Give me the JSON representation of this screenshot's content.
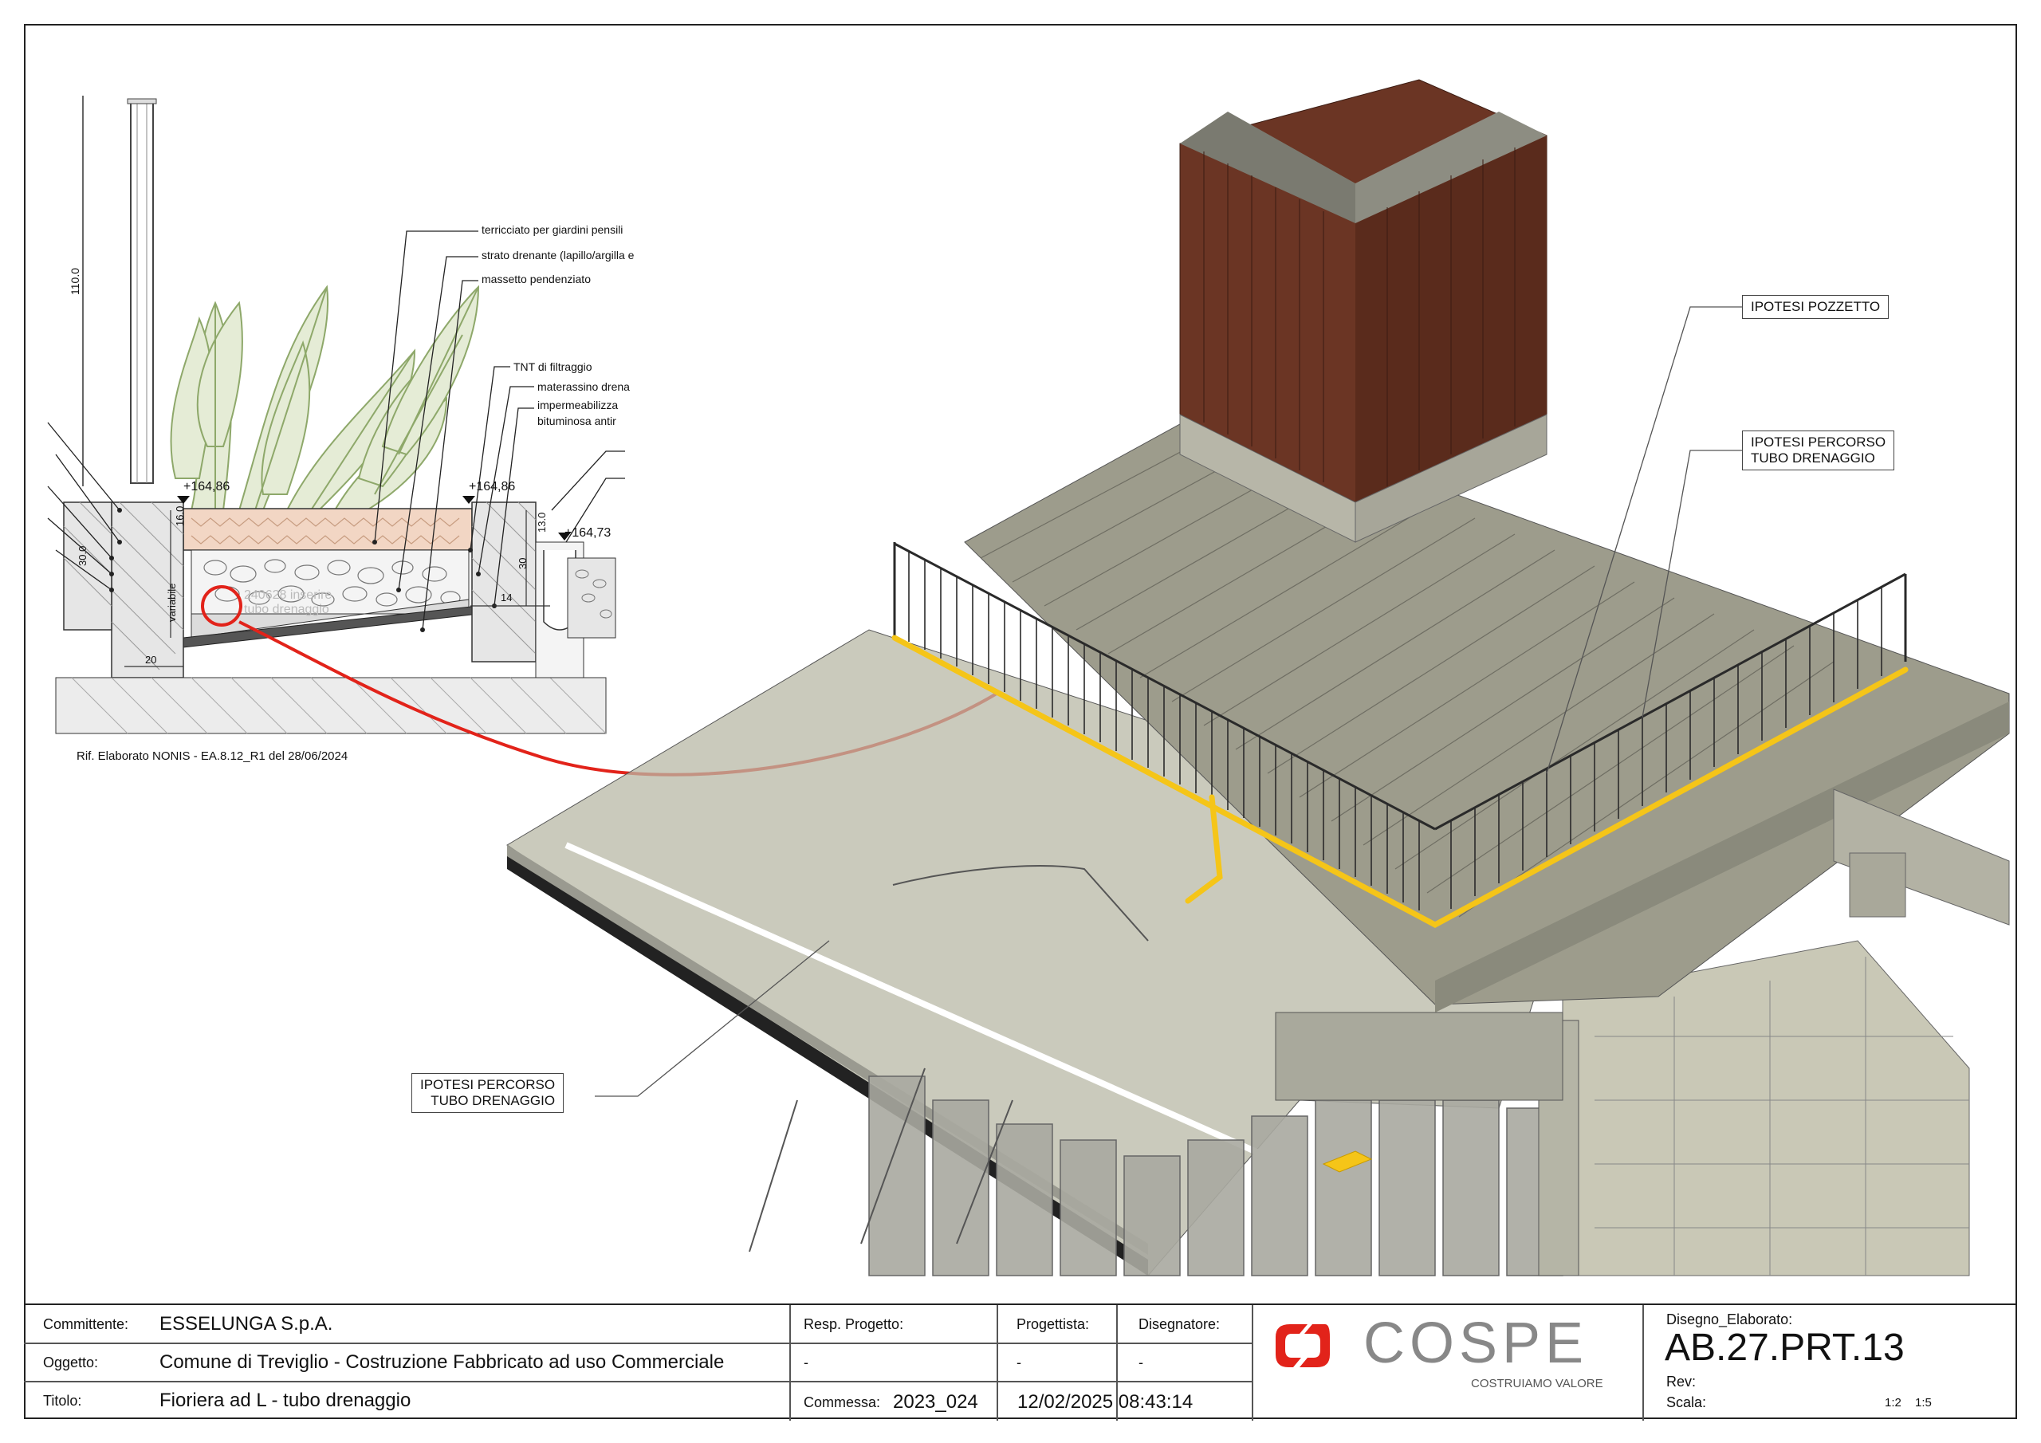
{
  "detail": {
    "labels": {
      "l1": "terricciato per giardini pensili",
      "l2": "strato drenante (lapillo/argilla e",
      "l3": "massetto pendenziato",
      "l4": "TNT di filtraggio",
      "l5": "materassino drena",
      "l6": "impermeabilizza",
      "l7": "bituminosa antir"
    },
    "dims": {
      "h110": "110.0",
      "h30a": "30.0",
      "varia": "variabile",
      "h16": "16.0",
      "w20": "20",
      "h13": "13.0",
      "h30b": "30",
      "w14": "14"
    },
    "levels": {
      "lv1": "+164,86",
      "lv2": "+164,86",
      "lv3": "+164,73"
    },
    "note": "240628 inserire tubo drenaggio",
    "reference": "Rif. Elaborato NONIS - EA.8.12_R1 del 28/06/2024"
  },
  "callouts": {
    "pozzetto": "IPOTESI POZZETTO",
    "percorso1_l1": "IPOTESI PERCORSO",
    "percorso1_l2": "TUBO DRENAGGIO",
    "percorso2_l1": "IPOTESI PERCORSO",
    "percorso2_l2": "TUBO DRENAGGIO"
  },
  "titleblock": {
    "committente_label": "Committente:",
    "committente": "ESSELUNGA S.p.A.",
    "oggetto_label": "Oggetto:",
    "oggetto": "Comune di Treviglio - Costruzione Fabbricato ad uso Commerciale",
    "titolo_label": "Titolo:",
    "titolo": "Fioriera ad L - tubo drenaggio",
    "resp_label": "Resp. Progetto:",
    "resp": "-",
    "progettista_label": "Progettista:",
    "progettista": "-",
    "disegnatore_label": "Disegnatore:",
    "disegnatore": "-",
    "commessa_label": "Commessa:",
    "commessa": "2023_024",
    "datetime": "12/02/2025 08:43:14",
    "logo_text": "COSPE",
    "logo_tagline": "COSTRUIAMO VALORE",
    "disegno_label": "Disegno_Elaborato:",
    "disegno": "AB.27.PRT.13",
    "rev_label": "Rev:",
    "scala_label": "Scala:",
    "scala1": "1:2",
    "scala2": "1:5"
  },
  "colors": {
    "accent_red": "#e2231a",
    "drain_yellow": "#f5c518",
    "brick": "#6b3524",
    "concrete": "#a7a79a",
    "plant": "#9cb27a"
  }
}
